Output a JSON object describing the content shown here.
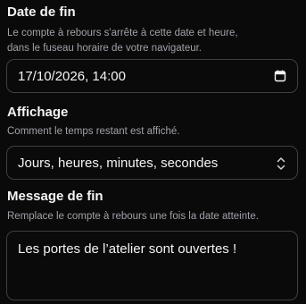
{
  "end_date": {
    "label": "Date de fin",
    "description_line1": "Le compte à rebours s'arrête à cette date et heure,",
    "description_line2": "dans le fuseau horaire de votre navigateur.",
    "value": "17/10/2026, 14:00",
    "icon": "calendar-icon"
  },
  "display": {
    "label": "Affichage",
    "description": "Comment le temps restant est affiché.",
    "selected": "Jours, heures, minutes, secondes",
    "icon": "chevron-up-down-icon"
  },
  "end_message": {
    "label": "Message de fin",
    "description": "Remplace le compte à rebours une fois la date atteinte.",
    "value": "Les portes de l’atelier sont ouvertes !"
  }
}
